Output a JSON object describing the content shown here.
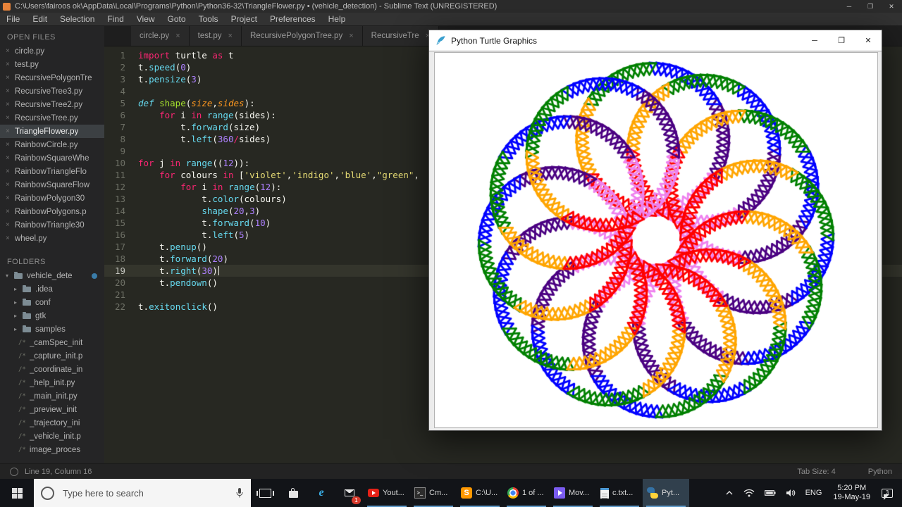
{
  "window": {
    "title": "C:\\Users\\fairoos ok\\AppData\\Local\\Programs\\Python\\Python36-32\\TriangleFlower.py • (vehicle_detection) - Sublime Text (UNREGISTERED)",
    "controls": {
      "minimize": "─",
      "maximize": "❐",
      "close": "✕"
    }
  },
  "menu": [
    "File",
    "Edit",
    "Selection",
    "Find",
    "View",
    "Goto",
    "Tools",
    "Project",
    "Preferences",
    "Help"
  ],
  "sidebar": {
    "open_files_header": "OPEN FILES",
    "selected_file": "TriangleFlower.py",
    "open_files": [
      "circle.py",
      "test.py",
      "RecursivePolygonTre",
      "RecursiveTree3.py",
      "RecursiveTree2.py",
      "RecursiveTree.py",
      "TriangleFlower.py",
      "RainbowCircle.py",
      "RainbowSquareWhe",
      "RainbowTriangleFlo",
      "RainbowSquareFlow",
      "RainbowPolygon30",
      "RainbowPolygons.p",
      "RainbowTriangle30",
      "wheel.py"
    ],
    "folders_header": "FOLDERS",
    "root_folder": "vehicle_dete",
    "subfolders": [
      ".idea",
      "conf",
      "gtk",
      "samples"
    ],
    "folder_files": [
      "_camSpec_init",
      "_capture_init.p",
      "_coordinate_in",
      "_help_init.py",
      "_main_init.py",
      "_preview_init",
      "_trajectory_ini",
      "_vehicle_init.p",
      "image_proces"
    ]
  },
  "tabs": [
    "circle.py",
    "test.py",
    "RecursivePolygonTree.py",
    "RecursiveTre"
  ],
  "code": {
    "cursor": {
      "line": 19,
      "column": 16
    },
    "lines": [
      [
        [
          "k",
          "import"
        ],
        [
          "t",
          " turtle "
        ],
        [
          "k",
          "as"
        ],
        [
          "t",
          " t"
        ]
      ],
      [
        [
          "t",
          "t."
        ],
        [
          "f",
          "speed"
        ],
        [
          "t",
          "("
        ],
        [
          "n",
          "0"
        ],
        [
          "t",
          ")"
        ]
      ],
      [
        [
          "t",
          "t."
        ],
        [
          "f",
          "pensize"
        ],
        [
          "t",
          "("
        ],
        [
          "n",
          "3"
        ],
        [
          "t",
          ")"
        ]
      ],
      [],
      [
        [
          "d",
          "def"
        ],
        [
          "t",
          " "
        ],
        [
          "g",
          "shape"
        ],
        [
          "t",
          "("
        ],
        [
          "p",
          "size"
        ],
        [
          "t",
          ","
        ],
        [
          "p",
          "sides"
        ],
        [
          "t",
          "):"
        ]
      ],
      [
        [
          "t",
          "    "
        ],
        [
          "k",
          "for"
        ],
        [
          "t",
          " i "
        ],
        [
          "k",
          "in"
        ],
        [
          "t",
          " "
        ],
        [
          "f",
          "range"
        ],
        [
          "t",
          "(sides):"
        ]
      ],
      [
        [
          "t",
          "        t."
        ],
        [
          "f",
          "forward"
        ],
        [
          "t",
          "(size)"
        ]
      ],
      [
        [
          "t",
          "        t."
        ],
        [
          "f",
          "left"
        ],
        [
          "t",
          "("
        ],
        [
          "n",
          "360"
        ],
        [
          "k",
          "/"
        ],
        [
          "t",
          "sides)"
        ]
      ],
      [],
      [
        [
          "k",
          "for"
        ],
        [
          "t",
          " j "
        ],
        [
          "k",
          "in"
        ],
        [
          "t",
          " "
        ],
        [
          "f",
          "range"
        ],
        [
          "t",
          "(("
        ],
        [
          "n",
          "12"
        ],
        [
          "t",
          ")):"
        ]
      ],
      [
        [
          "t",
          "    "
        ],
        [
          "k",
          "for"
        ],
        [
          "t",
          " colours "
        ],
        [
          "k",
          "in"
        ],
        [
          "t",
          " ["
        ],
        [
          "s",
          "'violet'"
        ],
        [
          "t",
          ","
        ],
        [
          "s",
          "'indigo'"
        ],
        [
          "t",
          ","
        ],
        [
          "s",
          "'blue'"
        ],
        [
          "t",
          ","
        ],
        [
          "s",
          "\"green\""
        ],
        [
          "t",
          ","
        ]
      ],
      [
        [
          "t",
          "        "
        ],
        [
          "k",
          "for"
        ],
        [
          "t",
          " i "
        ],
        [
          "k",
          "in"
        ],
        [
          "t",
          " "
        ],
        [
          "f",
          "range"
        ],
        [
          "t",
          "("
        ],
        [
          "n",
          "12"
        ],
        [
          "t",
          "):"
        ]
      ],
      [
        [
          "t",
          "            t."
        ],
        [
          "f",
          "color"
        ],
        [
          "t",
          "(colours)"
        ]
      ],
      [
        [
          "t",
          "            "
        ],
        [
          "f",
          "shape"
        ],
        [
          "t",
          "("
        ],
        [
          "n",
          "20"
        ],
        [
          "t",
          ","
        ],
        [
          "n",
          "3"
        ],
        [
          "t",
          ")"
        ]
      ],
      [
        [
          "t",
          "            t."
        ],
        [
          "f",
          "forward"
        ],
        [
          "t",
          "("
        ],
        [
          "n",
          "10"
        ],
        [
          "t",
          ")"
        ]
      ],
      [
        [
          "t",
          "            t."
        ],
        [
          "f",
          "left"
        ],
        [
          "t",
          "("
        ],
        [
          "n",
          "5"
        ],
        [
          "t",
          ")"
        ]
      ],
      [
        [
          "t",
          "    t."
        ],
        [
          "f",
          "penup"
        ],
        [
          "t",
          "()"
        ]
      ],
      [
        [
          "t",
          "    t."
        ],
        [
          "f",
          "forward"
        ],
        [
          "t",
          "("
        ],
        [
          "n",
          "20"
        ],
        [
          "t",
          ")"
        ]
      ],
      [
        [
          "t",
          "    t."
        ],
        [
          "f",
          "right"
        ],
        [
          "t",
          "("
        ],
        [
          "n",
          "30"
        ],
        [
          "t",
          ")"
        ]
      ],
      [
        [
          "t",
          "    t."
        ],
        [
          "f",
          "pendown"
        ],
        [
          "t",
          "()"
        ]
      ],
      [],
      [
        [
          "t",
          "t."
        ],
        [
          "f",
          "exitonclick"
        ],
        [
          "t",
          "()"
        ]
      ]
    ]
  },
  "statusbar": {
    "position": "Line 19, Column 16",
    "tab_size": "Tab Size: 4",
    "syntax": "Python"
  },
  "turtle_window": {
    "title": "Python Turtle Graphics",
    "colors": [
      "#EE82EE",
      "#4B0082",
      "#0000FF",
      "#008000",
      "#FFA500",
      "#FF0000"
    ],
    "pattern": {
      "rings": 12,
      "triangles_per_color": 12,
      "triangle_size": 20,
      "step": 10,
      "turn": 5,
      "ring_step": 20,
      "ring_turn": 30,
      "pensize": 3
    }
  },
  "taskbar": {
    "search_placeholder": "Type here to search",
    "mail_badge": "1",
    "apps": [
      {
        "id": "youtube",
        "label": "Yout..."
      },
      {
        "id": "cmd",
        "label": "Cm..."
      },
      {
        "id": "sublime",
        "label": "C:\\U..."
      },
      {
        "id": "chrome",
        "label": "1 of ..."
      },
      {
        "id": "movies",
        "label": "Mov..."
      },
      {
        "id": "notepad",
        "label": "c.txt..."
      },
      {
        "id": "python",
        "label": "Pyt...",
        "active": true
      }
    ],
    "tray": {
      "lang": "ENG",
      "time": "5:20 PM",
      "date": "19-May-19",
      "badge": "3"
    }
  }
}
